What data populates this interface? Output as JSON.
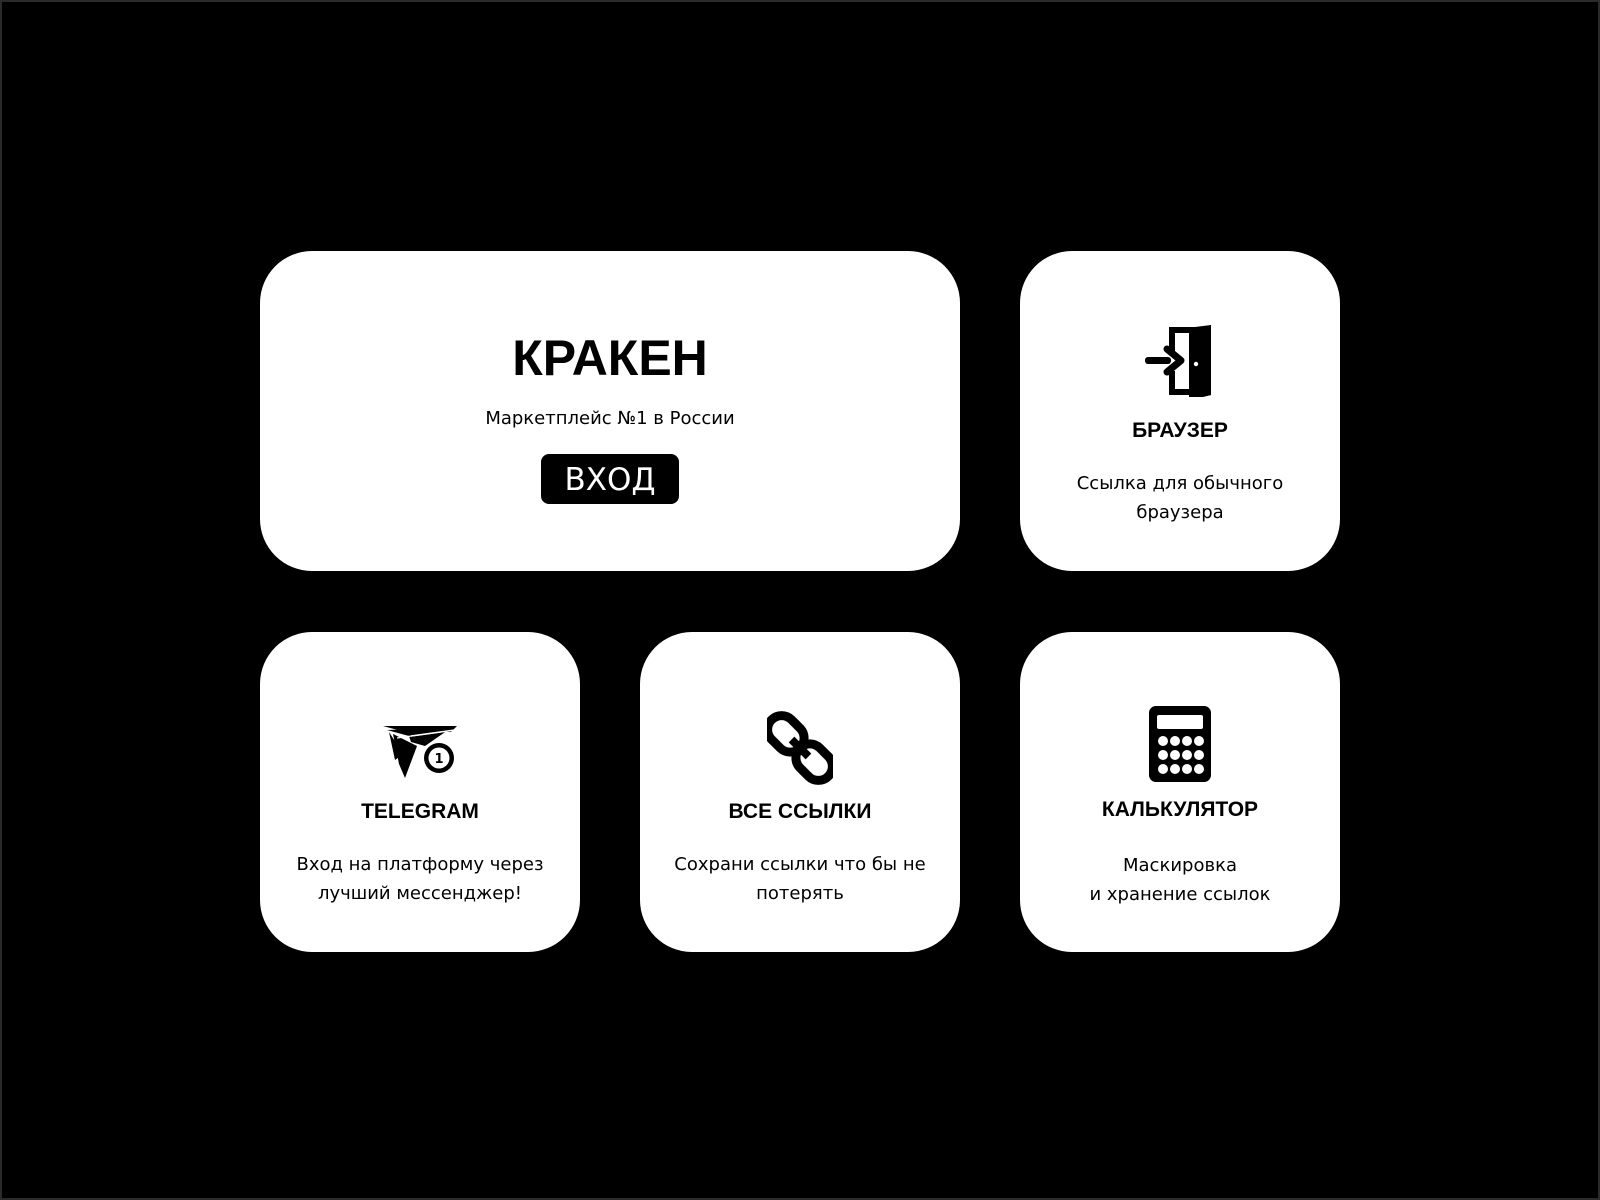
{
  "hero": {
    "title": "КРАКЕН",
    "subtitle": "Маркетплейс №1 в России",
    "button_label": "ВХОД"
  },
  "cards": [
    {
      "id": "browser",
      "icon": "door-enter-icon",
      "title": "БРАУЗЕР",
      "desc_lines": [
        "Ссылка для обычного",
        "браузера"
      ]
    },
    {
      "id": "telegram",
      "icon": "paper-plane-notification-icon",
      "badge": "1",
      "title": "TELEGRAM",
      "desc_lines": [
        "Вход на платформу через",
        "лучший мессенджер!"
      ]
    },
    {
      "id": "links",
      "icon": "chain-link-icon",
      "title": "ВСЕ ССЫЛКИ",
      "desc_lines": [
        "Сохрани ссылки что бы не",
        "потерять"
      ]
    },
    {
      "id": "calculator",
      "icon": "calculator-icon",
      "title": "КАЛЬКУЛЯТОР",
      "desc_lines": [
        "Маскировка",
        "и хранение ссылок"
      ]
    }
  ],
  "colors": {
    "background": "#000000",
    "card": "#ffffff",
    "text": "#000000",
    "button_bg": "#000000",
    "button_text": "#ffffff"
  }
}
